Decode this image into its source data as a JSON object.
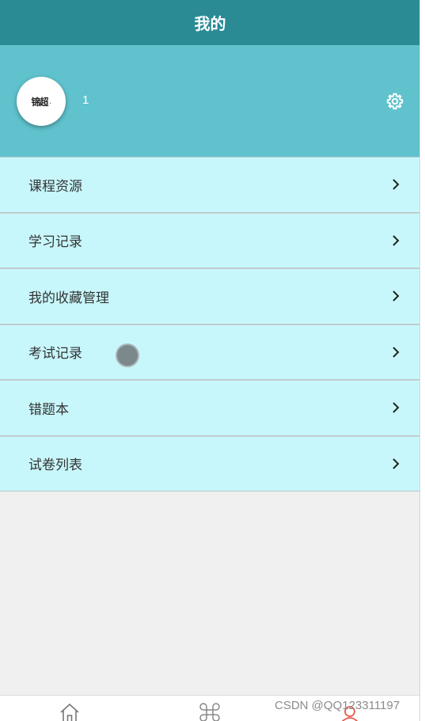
{
  "header": {
    "title": "我的"
  },
  "profile": {
    "avatar_text": "锦超",
    "avatar_dot": ".",
    "username": "1",
    "settings_icon": "gear-icon"
  },
  "menu": {
    "items": [
      {
        "label": "课程资源",
        "icon": "chevron-right-icon"
      },
      {
        "label": "学习记录",
        "icon": "chevron-right-icon"
      },
      {
        "label": "我的收藏管理",
        "icon": "chevron-right-icon"
      },
      {
        "label": "考试记录",
        "icon": "chevron-right-icon"
      },
      {
        "label": "错题本",
        "icon": "chevron-right-icon"
      },
      {
        "label": "试卷列表",
        "icon": "chevron-right-icon"
      }
    ]
  },
  "tabbar": {
    "items": [
      {
        "icon": "home-icon"
      },
      {
        "icon": "command-icon"
      },
      {
        "icon": "user-icon",
        "active": true
      }
    ]
  },
  "watermark": {
    "text": "CSDN @QQ123311197"
  },
  "colors": {
    "nav_bg": "#2a8b95",
    "profile_bg": "#5fc2cd",
    "menu_bg": "#c8f7fb",
    "page_bg": "#f0f0f0",
    "active_tab": "#e85a4f"
  }
}
